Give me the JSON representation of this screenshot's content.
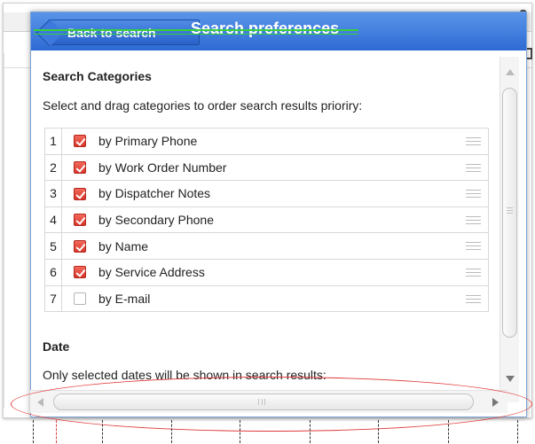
{
  "header": {
    "back_label": "Back to search",
    "title": "Search preferences",
    "help_glyph": "?"
  },
  "categories_section": {
    "title": "Search Categories",
    "description": "Select and drag categories to order search results prioriry:",
    "items": [
      {
        "num": "1",
        "label": "by Primary Phone",
        "checked": true
      },
      {
        "num": "2",
        "label": "by Work Order Number",
        "checked": true
      },
      {
        "num": "3",
        "label": "by Dispatcher Notes",
        "checked": true
      },
      {
        "num": "4",
        "label": "by Secondary Phone",
        "checked": true
      },
      {
        "num": "5",
        "label": "by Name",
        "checked": true
      },
      {
        "num": "6",
        "label": "by Service Address",
        "checked": true
      },
      {
        "num": "7",
        "label": "by E-mail",
        "checked": false
      }
    ]
  },
  "date_section": {
    "title": "Date",
    "description": "Only selected dates will be shown in search results:"
  },
  "colors": {
    "header_blue": "#2e6bd3",
    "checkbox_red": "#d8352a",
    "annotation_red": "#e23a3a",
    "annotation_green": "#36d13a"
  },
  "icons": {
    "back": "left-arrow-tab",
    "check": "check-icon",
    "drag": "drag-handle-icon",
    "scroll_up": "triangle-up-icon",
    "scroll_down": "triangle-down-icon",
    "scroll_left": "triangle-left-icon",
    "scroll_right": "triangle-right-icon"
  }
}
